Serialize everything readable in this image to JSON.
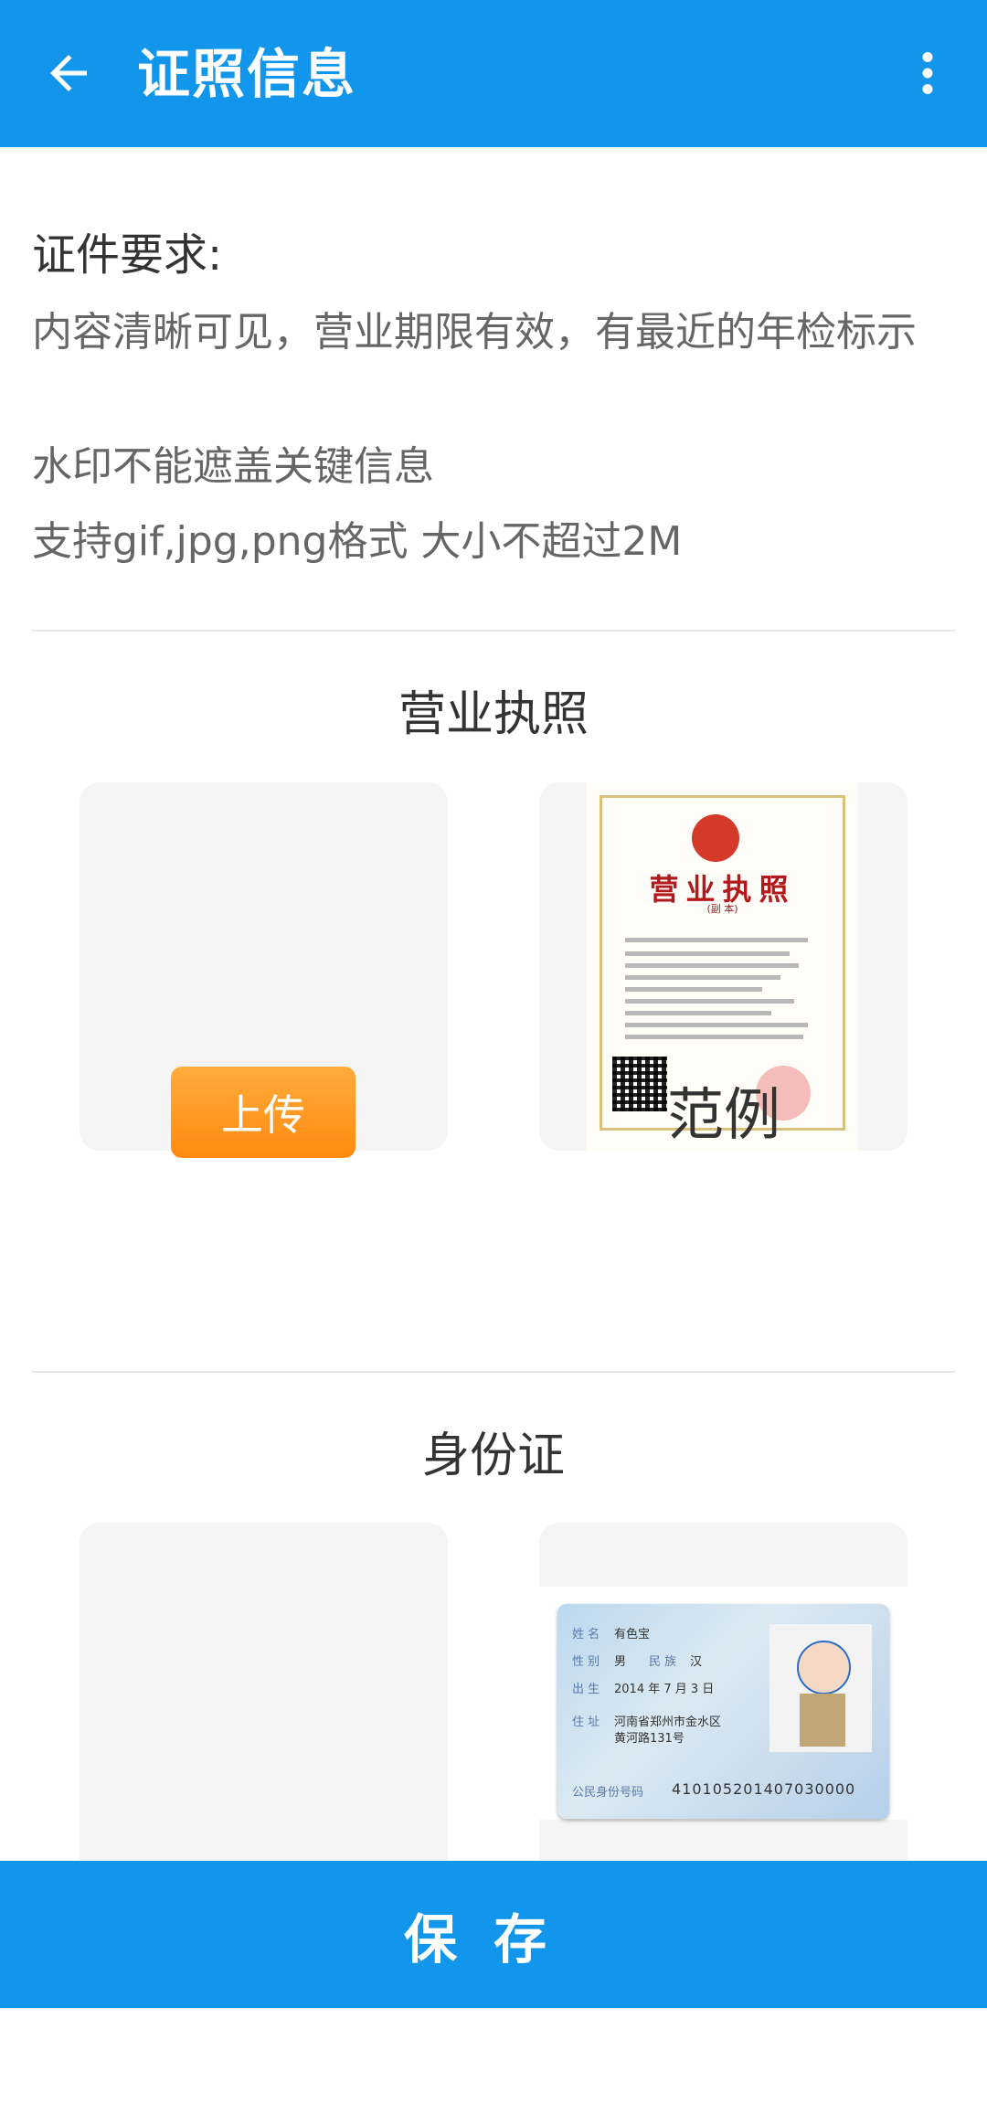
{
  "app_bar": {
    "title": "证照信息",
    "back_icon": "arrow-left-icon",
    "more_icon": "more-vert-icon",
    "color": "#1296ec"
  },
  "requirements": {
    "title": "证件要求:",
    "lines": [
      "内容清晰可见，营业期限有效，有最近的年检标示",
      "水印不能遮盖关键信息",
      "支持gif,jpg,png格式 大小不超过2M"
    ]
  },
  "business_license": {
    "section_title": "营业执照",
    "upload_label": "上传",
    "example_label": "范例",
    "sample": {
      "title": "营业执照",
      "subtitle": "(副 本)"
    }
  },
  "id_card": {
    "section_title": "身份证",
    "sample": {
      "name_label": "姓 名",
      "name": "有色宝",
      "sex_label": "性 别",
      "sex": "男",
      "ethnic_label": "民 族",
      "ethnic": "汉",
      "birth_label": "出 生",
      "birth": "2014  年 7 月 3 日",
      "address_label": "住 址",
      "address_line1": "河南省郑州市金水区",
      "address_line2": "黄河路131号",
      "id_label": "公民身份号码",
      "id_number": "410105201407030000"
    }
  },
  "save_button": {
    "label": "保存",
    "color": "#1296ec"
  }
}
